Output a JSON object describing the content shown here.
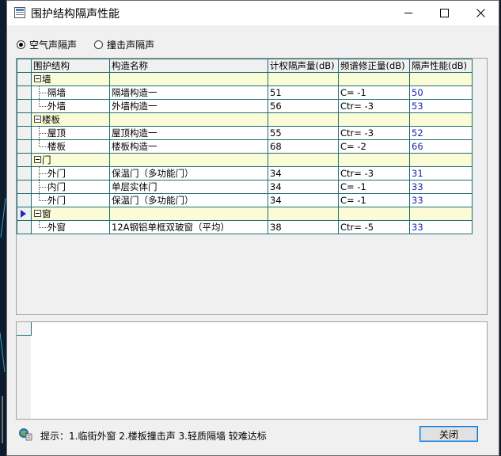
{
  "window": {
    "title": "围护结构隔声性能"
  },
  "radios": [
    {
      "label": "空气声隔声",
      "checked": true
    },
    {
      "label": "撞击声隔声",
      "checked": false
    }
  ],
  "grid": {
    "columns": [
      "围护结构",
      "构造名称",
      "计权隔声量(dB)",
      "频谱修正量(dB)",
      "隔声性能(dB)"
    ],
    "rows": [
      {
        "type": "group",
        "name": "墙",
        "construction": "",
        "rw": "",
        "corr": "",
        "perf": ""
      },
      {
        "type": "child",
        "name": "隔墙",
        "construction": "隔墙构造一",
        "rw": "51",
        "corr": "C= -1",
        "perf": "50"
      },
      {
        "type": "child",
        "name": "外墙",
        "construction": "外墙构造一",
        "rw": "56",
        "corr": "Ctr= -3",
        "perf": "53",
        "last": true
      },
      {
        "type": "group",
        "name": "楼板",
        "construction": "",
        "rw": "",
        "corr": "",
        "perf": ""
      },
      {
        "type": "child",
        "name": "屋顶",
        "construction": "屋顶构造一",
        "rw": "55",
        "corr": "Ctr= -3",
        "perf": "52"
      },
      {
        "type": "child",
        "name": "楼板",
        "construction": "楼板构造一",
        "rw": "68",
        "corr": "C= -2",
        "perf": "66",
        "last": true
      },
      {
        "type": "group",
        "name": "门",
        "construction": "",
        "rw": "",
        "corr": "",
        "perf": ""
      },
      {
        "type": "child",
        "name": "外门",
        "construction": "保温门（多功能门）",
        "rw": "34",
        "corr": "Ctr= -3",
        "perf": "31"
      },
      {
        "type": "child",
        "name": "内门",
        "construction": "单层实体门",
        "rw": "34",
        "corr": "C= -1",
        "perf": "33"
      },
      {
        "type": "child",
        "name": "外门",
        "construction": "保温门（多功能门）",
        "rw": "34",
        "corr": "C= -1",
        "perf": "33",
        "last": true
      },
      {
        "type": "group",
        "name": "窗",
        "construction": "",
        "rw": "",
        "corr": "",
        "perf": "",
        "selected": true
      },
      {
        "type": "child",
        "name": "外窗",
        "construction": "12A钢铝单框双玻窗（平均）",
        "rw": "38",
        "corr": "Ctr= -5",
        "perf": "33",
        "last": true
      }
    ]
  },
  "footer": {
    "hint": "提示：1.临街外窗 2.楼板撞击声 3.轻质隔墙 较难达标",
    "close_label": "关闭"
  },
  "colors": {
    "perf_text": "#1a23b5",
    "group_bg": "#fbfbd8",
    "grid_line": "#1c6f6f"
  }
}
